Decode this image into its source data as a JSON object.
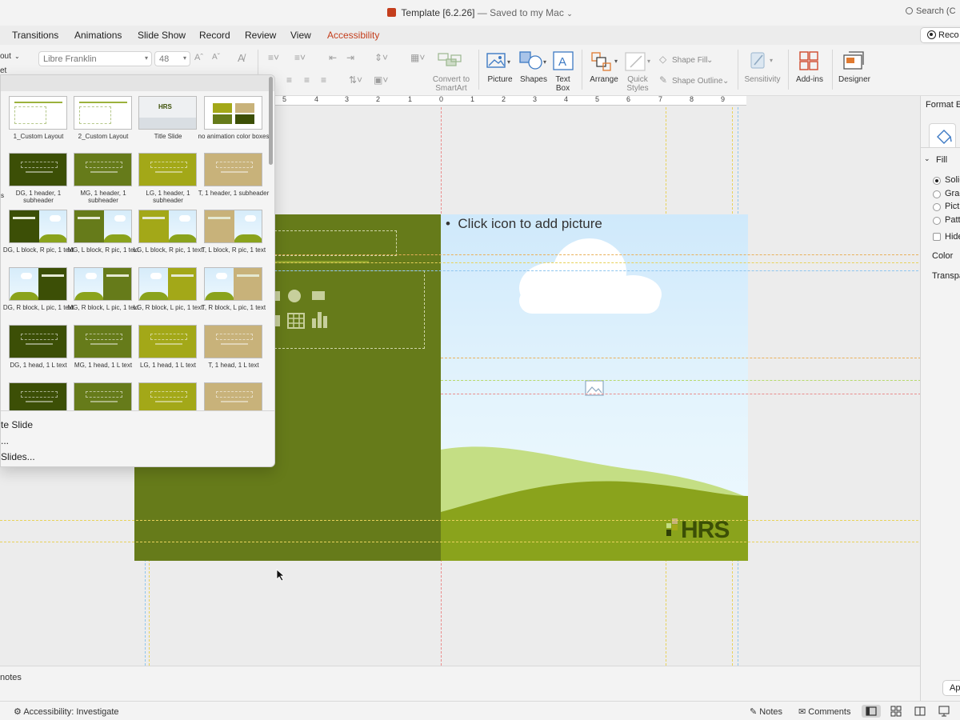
{
  "window": {
    "title": "Template [6.2.26]",
    "saved_status": "— Saved to my Mac",
    "search_label": "Search (C"
  },
  "tabs": [
    {
      "label": "Transitions"
    },
    {
      "label": "Animations"
    },
    {
      "label": "Slide Show"
    },
    {
      "label": "Record"
    },
    {
      "label": "Review"
    },
    {
      "label": "View"
    },
    {
      "label": "Accessibility",
      "active": true
    }
  ],
  "record_button": "Reco",
  "ribbon": {
    "layout_label": "out",
    "reset_label": "et",
    "font_name": "Libre Franklin",
    "font_size": "48",
    "convert_smartart": "Convert to SmartArt",
    "picture": "Picture",
    "shapes": "Shapes",
    "text_box": "Text Box",
    "arrange": "Arrange",
    "quick_styles": "Quick Styles",
    "shape_fill": "Shape Fill",
    "shape_outline": "Shape Outline",
    "sensitivity": "Sensitivity",
    "add_ins": "Add-ins",
    "designer": "Designer"
  },
  "ruler_labels": [
    "5",
    "4",
    "3",
    "2",
    "1",
    "0",
    "1",
    "2",
    "3",
    "4",
    "5",
    "6",
    "7",
    "8",
    "9"
  ],
  "slide": {
    "placeholder": "Click icon to add picture",
    "bullet": "•",
    "logo": "HRS"
  },
  "gallery": {
    "layouts": [
      {
        "label": "1_Custom Layout",
        "style": "white"
      },
      {
        "label": "2_Custom Layout",
        "style": "white"
      },
      {
        "label": "Title Slide",
        "style": "title"
      },
      {
        "label": "no animation color boxes",
        "style": "boxes"
      },
      {
        "label": "DG, 1 header, 1 subheader",
        "style": "dg"
      },
      {
        "label": "MG, 1 header, 1 subheader",
        "style": "mg"
      },
      {
        "label": "LG, 1 header, 1 subheader",
        "style": "lg"
      },
      {
        "label": "T, 1 header, 1 subheader",
        "style": "t"
      },
      {
        "label": "DG, L block, R pic, 1 text",
        "style": "dg-pic-r"
      },
      {
        "label": "MG, L block, R pic, 1 text",
        "style": "mg-pic-r"
      },
      {
        "label": "LG, L block, R pic, 1 text",
        "style": "lg-pic-r"
      },
      {
        "label": "T, L block, R pic, 1 text",
        "style": "t-pic-r"
      },
      {
        "label": "DG, R block, L pic, 1 text",
        "style": "dg-pic-l"
      },
      {
        "label": "MG, R block, L pic, 1 text",
        "style": "mg-pic-l"
      },
      {
        "label": "LG, R block, L pic, 1 text",
        "style": "lg-pic-l"
      },
      {
        "label": "T, R block, L pic, 1 text",
        "style": "t-pic-l"
      },
      {
        "label": "DG, 1 head, 1 L text",
        "style": "dg"
      },
      {
        "label": "MG, 1 head, 1 L text",
        "style": "mg"
      },
      {
        "label": "LG, 1 head, 1 L text",
        "style": "lg"
      },
      {
        "label": "T, 1 head, 1 L text",
        "style": "t"
      },
      {
        "label": "",
        "style": "dg"
      },
      {
        "label": "",
        "style": "mg"
      },
      {
        "label": "",
        "style": "lg"
      },
      {
        "label": "",
        "style": "t"
      }
    ],
    "side_label": "s",
    "menu": {
      "duplicate": "te Slide",
      "reuse": "...",
      "reuse_slides": "Slides..."
    }
  },
  "format_pane": {
    "title": "Format E",
    "fill_header": "Fill",
    "options": [
      "Solic",
      "Grac",
      "Pictu",
      "Patt"
    ],
    "hide": "Hide",
    "color": "Color",
    "transparency": "Transpa",
    "apply": "Ap"
  },
  "notes_label": "notes",
  "status": {
    "accessibility": "Accessibility: Investigate",
    "notes": "Notes",
    "comments": "Comments"
  },
  "colors": {
    "dark_green": "#3c4f06",
    "mid_green": "#667b1a",
    "light_green": "#a3a818",
    "tan": "#c8b27a",
    "accent": "#c43e1c"
  }
}
